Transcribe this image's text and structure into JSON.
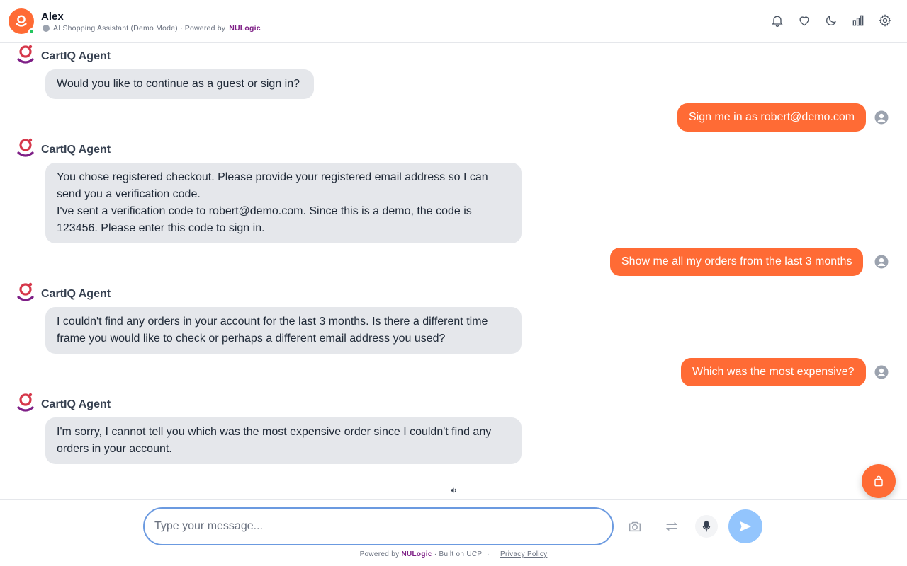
{
  "header": {
    "user_name": "Alex",
    "subtitle_prefix": "AI Shopping Assistant (Demo Mode) · Powered by",
    "brand": "NULogic",
    "icons": [
      "bell-icon",
      "heart-icon",
      "moon-icon",
      "chart-icon",
      "gear-icon"
    ]
  },
  "agent_name": "CartIQ Agent",
  "messages": [
    {
      "role": "agent",
      "text": "Would you like to continue as a guest or sign in?"
    },
    {
      "role": "user",
      "text": "Sign me in as robert@demo.com"
    },
    {
      "role": "agent",
      "line1": "You chose registered checkout. Please provide your registered email address so I can send you a verification code.",
      "line2": "I've sent a verification code to robert@demo.com. Since this is a demo, the code is 123456. Please enter this code to sign in."
    },
    {
      "role": "user",
      "text": "Show me all my orders from the last 3 months"
    },
    {
      "role": "agent",
      "text": "I couldn't find any orders in your account for the last 3 months. Is there a different time frame you would like to check or perhaps a different email address you used?"
    },
    {
      "role": "user",
      "text": "Which was the most expensive?"
    },
    {
      "role": "agent",
      "text": "I'm sorry, I cannot tell you which was the most expensive order since I couldn't find any orders in your account."
    }
  ],
  "input": {
    "placeholder": "Type your message...",
    "value": ""
  },
  "footer": {
    "powered_prefix": "Powered by",
    "brand": "NULogic",
    "built_on": "· Built on UCP",
    "sep": "·",
    "privacy": "Privacy Policy"
  },
  "colors": {
    "accent": "#ff6b35",
    "brand": "#7e1f86",
    "agent_bubble": "#e5e7eb",
    "send_button": "#93c5fd",
    "input_border": "#6b9ae0"
  }
}
